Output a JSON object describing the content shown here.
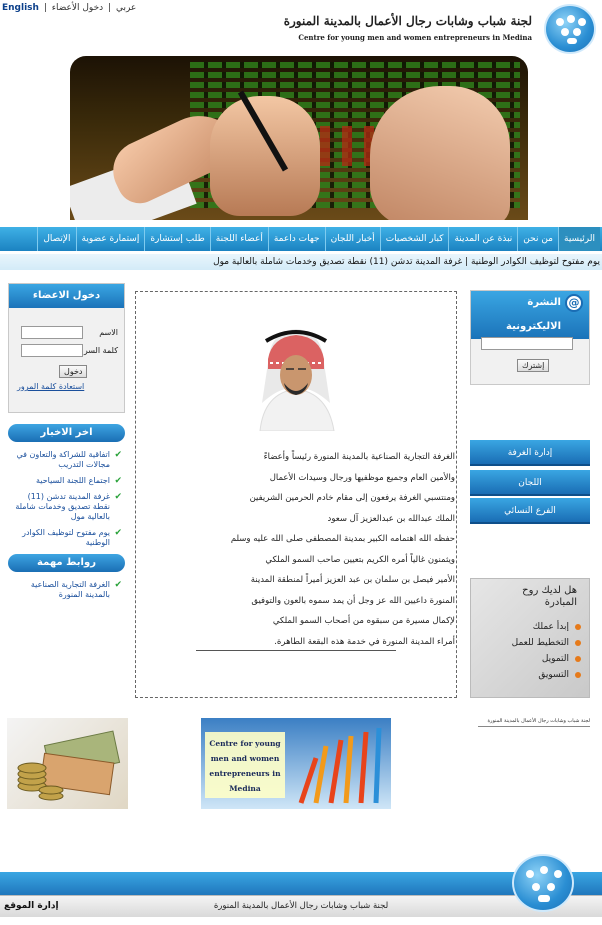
{
  "top_links": {
    "english": "English",
    "separator": "|",
    "arabic": "عربي",
    "members_login": "دخول الأعضاء"
  },
  "header": {
    "title_ar": "لجنة شباب وشابات رجال الأعمال بالمدينة المنورة",
    "title_en": "Centre for young men and women entrepreneurs in Medina"
  },
  "nav": {
    "items": [
      "الرئيسية",
      "من نحن",
      "نبذة عن المدينة",
      "كبار الشخصيات",
      "أخبار اللجان",
      "جهات داعمة",
      "أعضاء اللجنة",
      "طلب إستشارة",
      "إستمارة عضوية",
      "الإتصال"
    ]
  },
  "ticker": {
    "text": "يوم مفتوح لتوظيف الكوادر الوطنية | غرفة المدينة تدشن (11) نقطة تصديق وخدمات شاملة بالعالية مول"
  },
  "login": {
    "title": "دخول الاعضاء",
    "name_label": "الاسم",
    "password_label": "كلمة السر",
    "submit": "دخول",
    "recover": "استعادة كلمة المرور"
  },
  "news": {
    "title": "اخر الاخبار",
    "items": [
      "اتفاقية للشراكة والتعاون في مجالات التدريب",
      "اجتماع اللجنة السياحية",
      "غرفة المدينة تدشن (11) نقطة تصديق وخدمات شاملة بالعالية مول",
      "يوم مفتوح لتوظيف الكوادر الوطنية"
    ]
  },
  "links": {
    "title": "روابط مهمة",
    "items": [
      "الغرفة التجارية الصناعية بالمدينة المنورة"
    ]
  },
  "bio": {
    "lines": [
      "الغرفة التجارية الصناعية بالمدينة المنورة رئيساً وأعضاءً",
      "والأمين العام وجميع موظفيها ورجال وسيدات الأعمال",
      "ومنتسبي الغرفة يرفعون إلى مقام خادم الحرمين الشريفين",
      "الملك عبدالله بن عبدالعزيز آل سعود",
      "حفظه الله اهتمامه الكبير بمدينة المصطفى صلى الله عليه وسلم",
      "ويثمنون غالياً أمره الكريم بتعيين صاحب السمو الملكي",
      "الأمير فيصل بن سلمان بن عبد العزيز أميراً لمنطقة المدينة",
      "المنورة داعيين الله عز وجل أن يمد سموه بالعون والتوفيق",
      "لإكمال مسيرة من سبقوه من أصحاب السمو الملكي",
      "أمراء المدينة المنورة في خدمة هذه البقعة الطاهرة."
    ]
  },
  "newsletter": {
    "title": "النشرة الاليكترونية",
    "subscribe": "إشترك"
  },
  "right_menu": {
    "items": [
      "إدارة الغرفة",
      "اللجان",
      "الفرع النسائي"
    ]
  },
  "mubadara": {
    "title": "هل لديك روح المبادرة",
    "items": [
      "إبدأ عملك",
      "التخطيط للعمل",
      "التمويل",
      "التسويق"
    ]
  },
  "bottom": {
    "promo_text": "Centre for young men and women entrepreneurs in Medina",
    "small_logo_text": "لجنة شباب وشابات رجال الأعمال بالمدينة المنورة"
  },
  "footer": {
    "copyright": "لجنة شباب وشابات رجال الأعمال بالمدينة المنورة",
    "admin": "إدارة الموقع"
  },
  "colors": {
    "accent": "#1b82c1",
    "link": "#1a4f9c",
    "check": "#2aa23a",
    "bullet": "#e67a1a"
  }
}
